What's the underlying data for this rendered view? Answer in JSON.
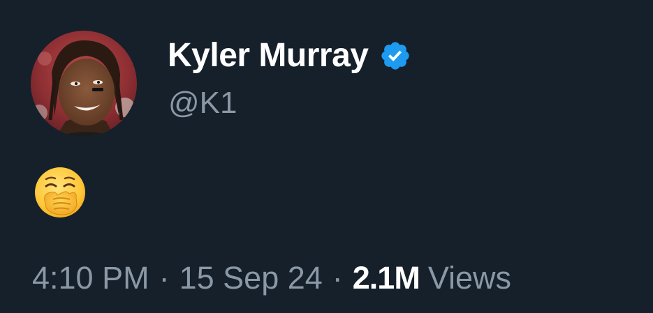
{
  "user": {
    "display_name": "Kyler Murray",
    "handle": "@K1",
    "verified": true,
    "verified_icon": "verified-badge-icon",
    "avatar_icon": "profile-photo"
  },
  "tweet": {
    "emoji": "yawning-face-icon"
  },
  "meta": {
    "time": "4:10 PM",
    "separator": "·",
    "date": "15 Sep 24",
    "views_count": "2.1M",
    "views_label": "Views"
  },
  "colors": {
    "background": "#15202b",
    "text_primary": "#ffffff",
    "text_secondary": "#8b98a5",
    "verified_blue": "#1d9bf0"
  }
}
